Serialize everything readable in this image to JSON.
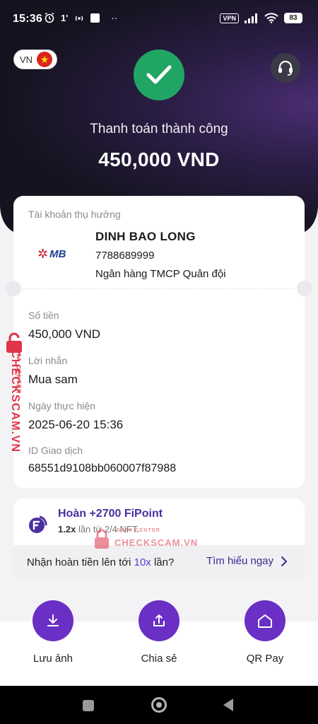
{
  "status_bar": {
    "time": "15:36",
    "small_text": "1'",
    "dots": "··",
    "vpn": "VPN",
    "battery": "83"
  },
  "header": {
    "language": "VN",
    "success_title": "Thanh toán thành công",
    "amount": "450,000 VND"
  },
  "receipt": {
    "account_label": "Tài khoản thụ hưởng",
    "bank_logo_text": "MB",
    "account_name": "DINH BAO LONG",
    "account_number": "7788689999",
    "bank_name": "Ngân hàng TMCP Quân đội",
    "amount_label": "Số tiền",
    "amount_value": "450,000 VND",
    "message_label": "Lời nhắn",
    "message_value": "Mua sam",
    "date_label": "Ngày thực hiện",
    "date_value": "2025-06-20 15:36",
    "txid_label": "ID Giao dịch",
    "txid_value": "68551d9108bb060007f87988"
  },
  "cashback": {
    "title": "Hoàn +2700 FiPoint",
    "sub_multiplier": "1.2x",
    "sub_rest": "lần từ 2/4 NFT.",
    "promo_prefix": "Nhận hoàn tiền lên tới",
    "promo_highlight": "10x",
    "promo_suffix": "lần?",
    "link": "Tìm hiểu ngay"
  },
  "actions": {
    "save": "Lưu ảnh",
    "share": "Chia sẻ",
    "qr": "QR Pay"
  },
  "watermark": {
    "brand": "CHECKSCAM.VN",
    "sub": "DATA CENTER"
  },
  "colors": {
    "success_green": "#21a565",
    "accent_purple": "#6a2fc4",
    "watermark_red": "#e0344a"
  }
}
